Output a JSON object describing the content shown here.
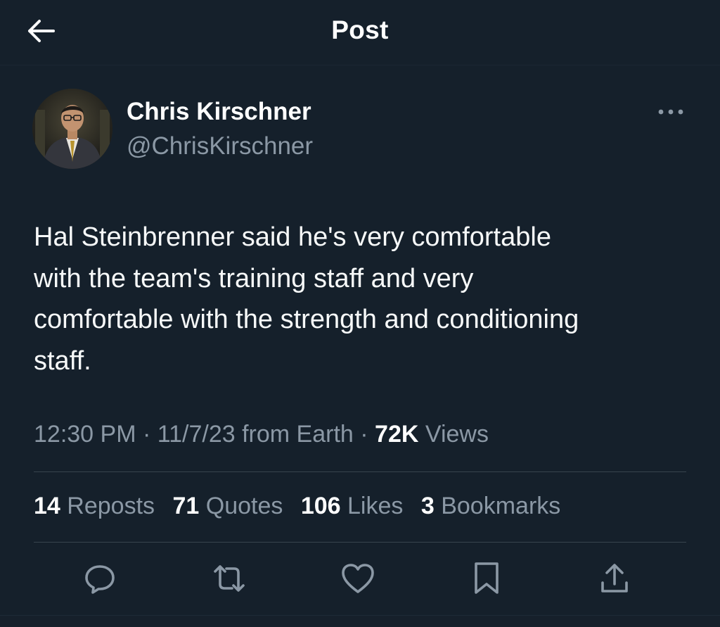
{
  "header": {
    "title": "Post",
    "back_icon": "arrow-left-icon"
  },
  "author": {
    "name": "Chris Kirschner",
    "handle": "@ChrisKirschner"
  },
  "post": {
    "lines": [
      "Hal Steinbrenner said he's very comfortable",
      "with the team's training staff and very",
      "comfortable with the strength and conditioning",
      "staff."
    ]
  },
  "meta": {
    "time": "12:30 PM",
    "sep1": " · ",
    "date_source": "11/7/23 from Earth",
    "sep2": " · ",
    "views_count": "72K",
    "views_label": "Views"
  },
  "stats": {
    "reposts_count": "14",
    "reposts_label": "Reposts",
    "quotes_count": "71",
    "quotes_label": "Quotes",
    "likes_count": "106",
    "likes_label": "Likes",
    "bookmarks_count": "3",
    "bookmarks_label": "Bookmarks"
  },
  "colors": {
    "background": "#15202b",
    "text_primary": "#f7f9f9",
    "text_secondary": "#8b98a5",
    "divider": "#38444d"
  },
  "actions": [
    "reply-icon",
    "repost-icon",
    "like-icon",
    "bookmark-icon",
    "share-icon"
  ]
}
